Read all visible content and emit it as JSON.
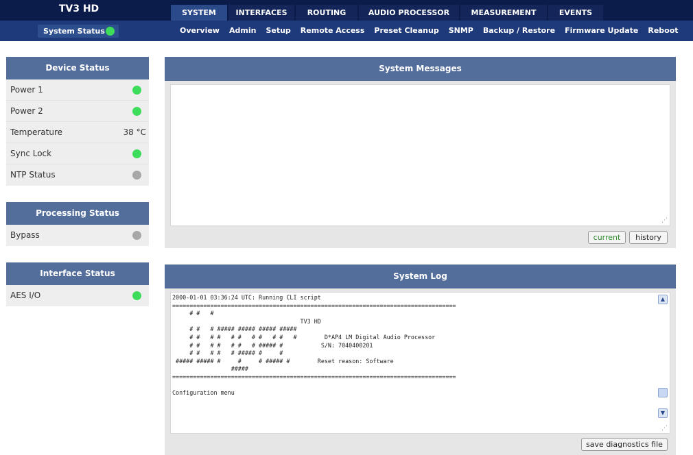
{
  "app": {
    "title": "TV3 HD"
  },
  "main_tabs": [
    {
      "label": "SYSTEM",
      "active": true
    },
    {
      "label": "INTERFACES",
      "active": false
    },
    {
      "label": "ROUTING",
      "active": false
    },
    {
      "label": "AUDIO PROCESSOR",
      "active": false
    },
    {
      "label": "MEASUREMENT",
      "active": false
    },
    {
      "label": "EVENTS",
      "active": false
    }
  ],
  "sub_nav": {
    "system_status": {
      "label": "System Status",
      "indicator_color": "#3ddc5a"
    },
    "tabs": [
      "Overview",
      "Admin",
      "Setup",
      "Remote Access",
      "Preset Cleanup",
      "SNMP",
      "Backup / Restore",
      "Firmware Update",
      "Reboot"
    ]
  },
  "device_status": {
    "title": "Device Status",
    "rows": [
      {
        "label": "Power 1",
        "indicator": "green"
      },
      {
        "label": "Power 2",
        "indicator": "green"
      },
      {
        "label": "Temperature",
        "value": "38 °C"
      },
      {
        "label": "Sync Lock",
        "indicator": "green"
      },
      {
        "label": "NTP Status",
        "indicator": "gray"
      }
    ]
  },
  "processing_status": {
    "title": "Processing Status",
    "rows": [
      {
        "label": "Bypass",
        "indicator": "gray"
      }
    ]
  },
  "interface_status": {
    "title": "Interface Status",
    "rows": [
      {
        "label": "AES I/O",
        "indicator": "green"
      }
    ]
  },
  "system_messages": {
    "title": "System Messages",
    "content": "",
    "buttons": {
      "current": "current",
      "history": "history"
    }
  },
  "system_log": {
    "title": "System Log",
    "lines": [
      "2000-01-01 03:36:24 UTC: Running CLI script",
      "==================================================================================",
      "     # #   #",
      "                                     TV3 HD",
      "     # #   # ##### ##### ##### #####",
      "     # #   # #   # #   # #   # #   #        D*AP4 LM Digital Audio Processor",
      "     # #   # #   # #   # ##### #           S/N: 7040400201",
      "     # #   # #   # ##### #     #",
      " ##### ##### #     #     # ##### #        Reset reason: Software",
      "                 #####",
      "==================================================================================",
      "",
      "Configuration menu"
    ],
    "save_button": "save diagnostics file"
  },
  "colors": {
    "topbar": "#0b1b4a",
    "subbar": "#1f3a7a",
    "panel_header": "#546e9c",
    "indicator_green": "#3ddc5a",
    "indicator_gray": "#a8a8a8",
    "current_button_text": "#2e8b2e"
  }
}
